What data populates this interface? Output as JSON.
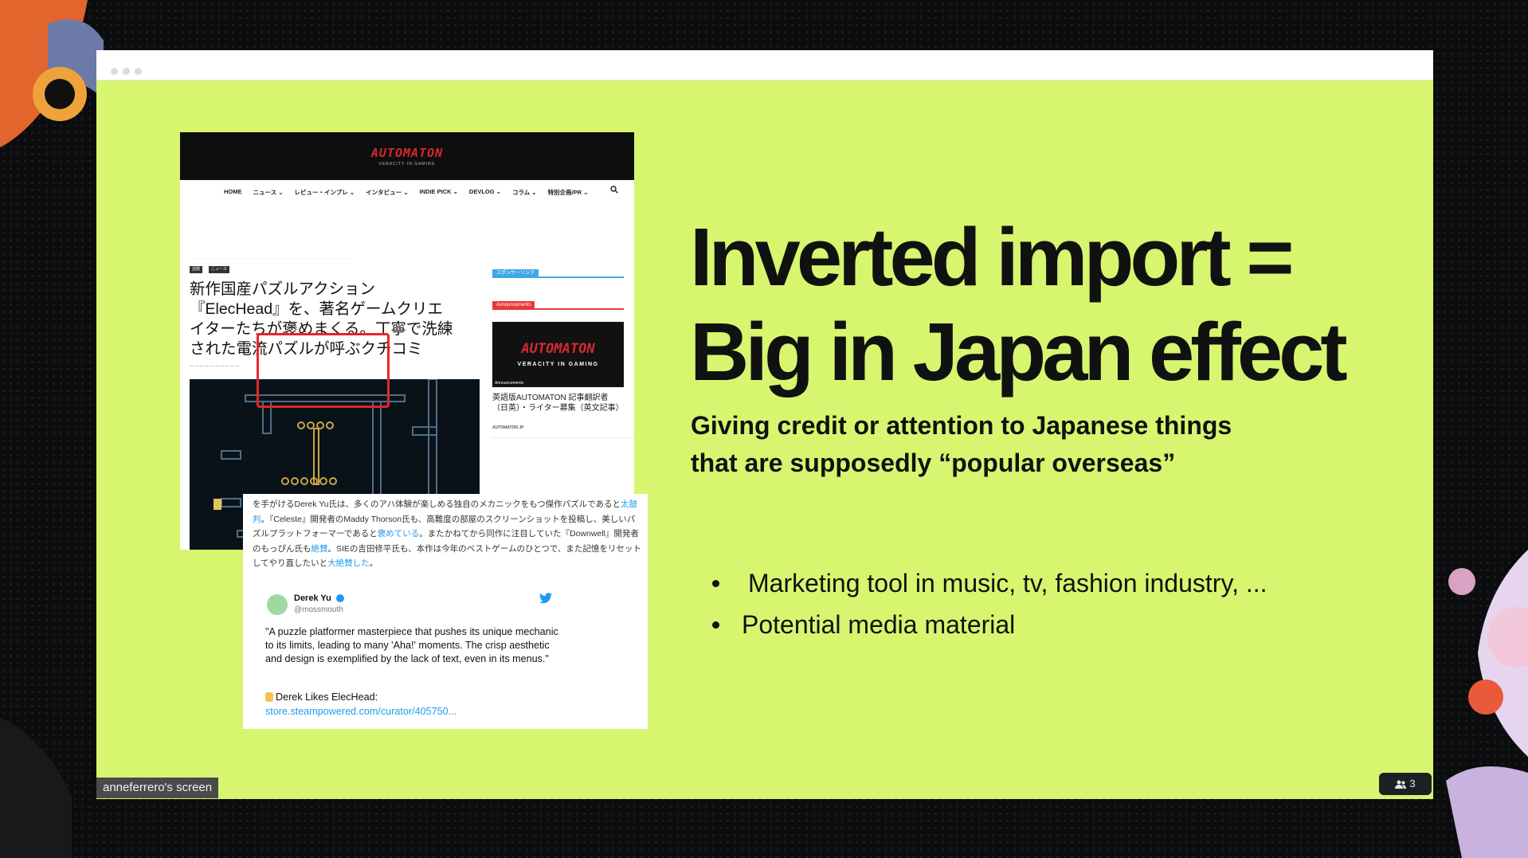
{
  "share": {
    "owner_label": "anneferrero's screen",
    "participants_count": "3",
    "slide_bg": "#d7f56f"
  },
  "article": {
    "site_logo": "AUTOMATON",
    "site_tagline": "VERACITY IN GAMING",
    "nav": [
      "HOME",
      "ニュース ⌄",
      "レビュー・インプレ ⌄",
      "インタビュー ⌄",
      "INDIE PICK ⌄",
      "DEVLOG ⌄",
      "コラム ⌄",
      "特別企画/PR ⌄"
    ],
    "tags": [
      "話題",
      "ニュース"
    ],
    "title_lines": [
      "新作国産パズルアクション",
      "『ElecHead』を、著名ゲームクリエ",
      "イターたちが褒めまくる。丁寧で洗練",
      "された電流パズルが呼ぶクチコミ"
    ],
    "sponsored_label": "スポンサーリンク",
    "announcements_label": "Announcements",
    "sidebar_title": "英語版AUTOMATON 記事翻訳者（日英）・ライター募集（英文記事）",
    "sidebar_meta": "AUTOMATON JP"
  },
  "quote": {
    "p1_a": "を手がけるDerek Yu氏は、多くのアハ体験が楽しめる独自のメカニックをもつ傑作パズルであると",
    "p1_link1": "太鼓判",
    "p1_b": "。『Celeste』開発者のMaddy Thorson氏も、高難度の部屋のスクリーンショットを投稿し、美しいパズルプラットフォーマーであると",
    "p1_link2": "褒めている",
    "p1_c": "。またかねてから同作に注目していた『Downwell』開発者のもっぴん氏も",
    "p1_link3": "絶賛",
    "p1_d": "。SIEの吉田修平氏も、本作は今年のベストゲームのひとつで、また記憶をリセットしてやり直したいと",
    "p1_link4": "大絶賛した",
    "p1_e": "。"
  },
  "tweet": {
    "name": "Derek Yu",
    "handle": "@mossmouth",
    "body": "\"A puzzle platformer masterpiece that pushes its unique mechanic to its limits, leading to many 'Aha!' moments. The crisp aesthetic and design is exemplified by the lack of text, even in its menus.\"",
    "likes": "Derek Likes ElecHead:",
    "link": "store.steampowered.com/curator/405750..."
  },
  "slide": {
    "heading_line1": "Inverted import =",
    "heading_line2": "Big in Japan effect",
    "subtitle_line1": "Giving credit or attention to Japanese things",
    "subtitle_line2": "that are supposedly “popular overseas”",
    "bullets": [
      "Marketing tool in music, tv, fashion industry, ...",
      "Potential media material"
    ]
  }
}
